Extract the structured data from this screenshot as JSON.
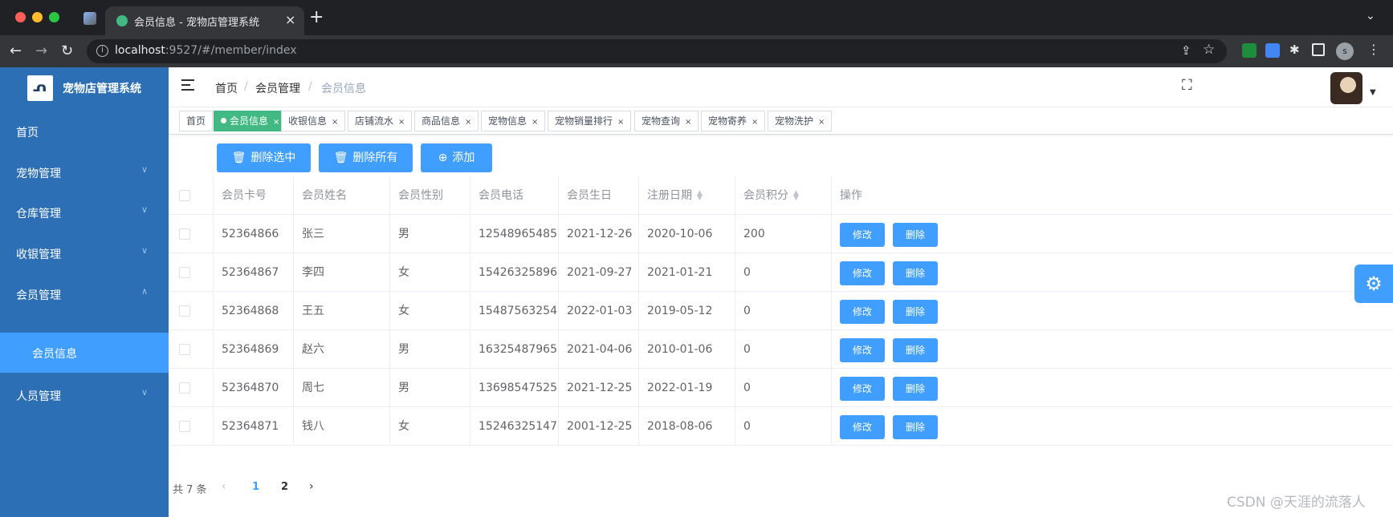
{
  "browser": {
    "tab_title": "会员信息 - 宠物店管理系统",
    "url_host": "localhost",
    "url_rest": ":9527/#/member/index",
    "profile_initial": "s"
  },
  "sidebar": {
    "app_title": "宠物店管理系统",
    "items": [
      {
        "label": "首页"
      },
      {
        "label": "宠物管理"
      },
      {
        "label": "仓库管理"
      },
      {
        "label": "收银管理"
      },
      {
        "label": "会员管理"
      },
      {
        "label": "会员信息"
      },
      {
        "label": "人员管理"
      }
    ]
  },
  "breadcrumb": {
    "home": "首页",
    "section": "会员管理",
    "current": "会员信息",
    "separator": "/"
  },
  "tags": [
    "首页",
    "会员信息",
    "收银信息",
    "店铺流水",
    "商品信息",
    "宠物信息",
    "宠物销量排行",
    "宠物查询",
    "宠物寄养",
    "宠物洗护"
  ],
  "toolbar": {
    "delete_selected": "删除选中",
    "delete_all": "删除所有",
    "add": "添加"
  },
  "table": {
    "headers": [
      "会员卡号",
      "会员姓名",
      "会员性别",
      "会员电话",
      "会员生日",
      "注册日期",
      "会员积分",
      "操作"
    ],
    "rows": [
      [
        "52364866",
        "张三",
        "男",
        "12548965485",
        "2021-12-26",
        "2020-10-06",
        "200"
      ],
      [
        "52364867",
        "李四",
        "女",
        "15426325896",
        "2021-09-27",
        "2021-01-21",
        "0"
      ],
      [
        "52364868",
        "王五",
        "女",
        "15487563254",
        "2022-01-03",
        "2019-05-12",
        "0"
      ],
      [
        "52364869",
        "赵六",
        "男",
        "16325487965",
        "2021-04-06",
        "2010-01-06",
        "0"
      ],
      [
        "52364870",
        "周七",
        "男",
        "13698547525",
        "2021-12-25",
        "2022-01-19",
        "0"
      ],
      [
        "52364871",
        "钱八",
        "女",
        "15246325147",
        "2001-12-25",
        "2018-08-06",
        "0"
      ]
    ],
    "edit_label": "修改",
    "delete_label": "删除"
  },
  "pagination": {
    "total": "共 7 条",
    "pages": [
      "1",
      "2"
    ],
    "current": "1"
  },
  "watermark": "CSDN @天涯的流落人",
  "colors": {
    "primary": "#409eff",
    "sidebar": "#2d6fb5",
    "active_tag": "#42b983"
  }
}
